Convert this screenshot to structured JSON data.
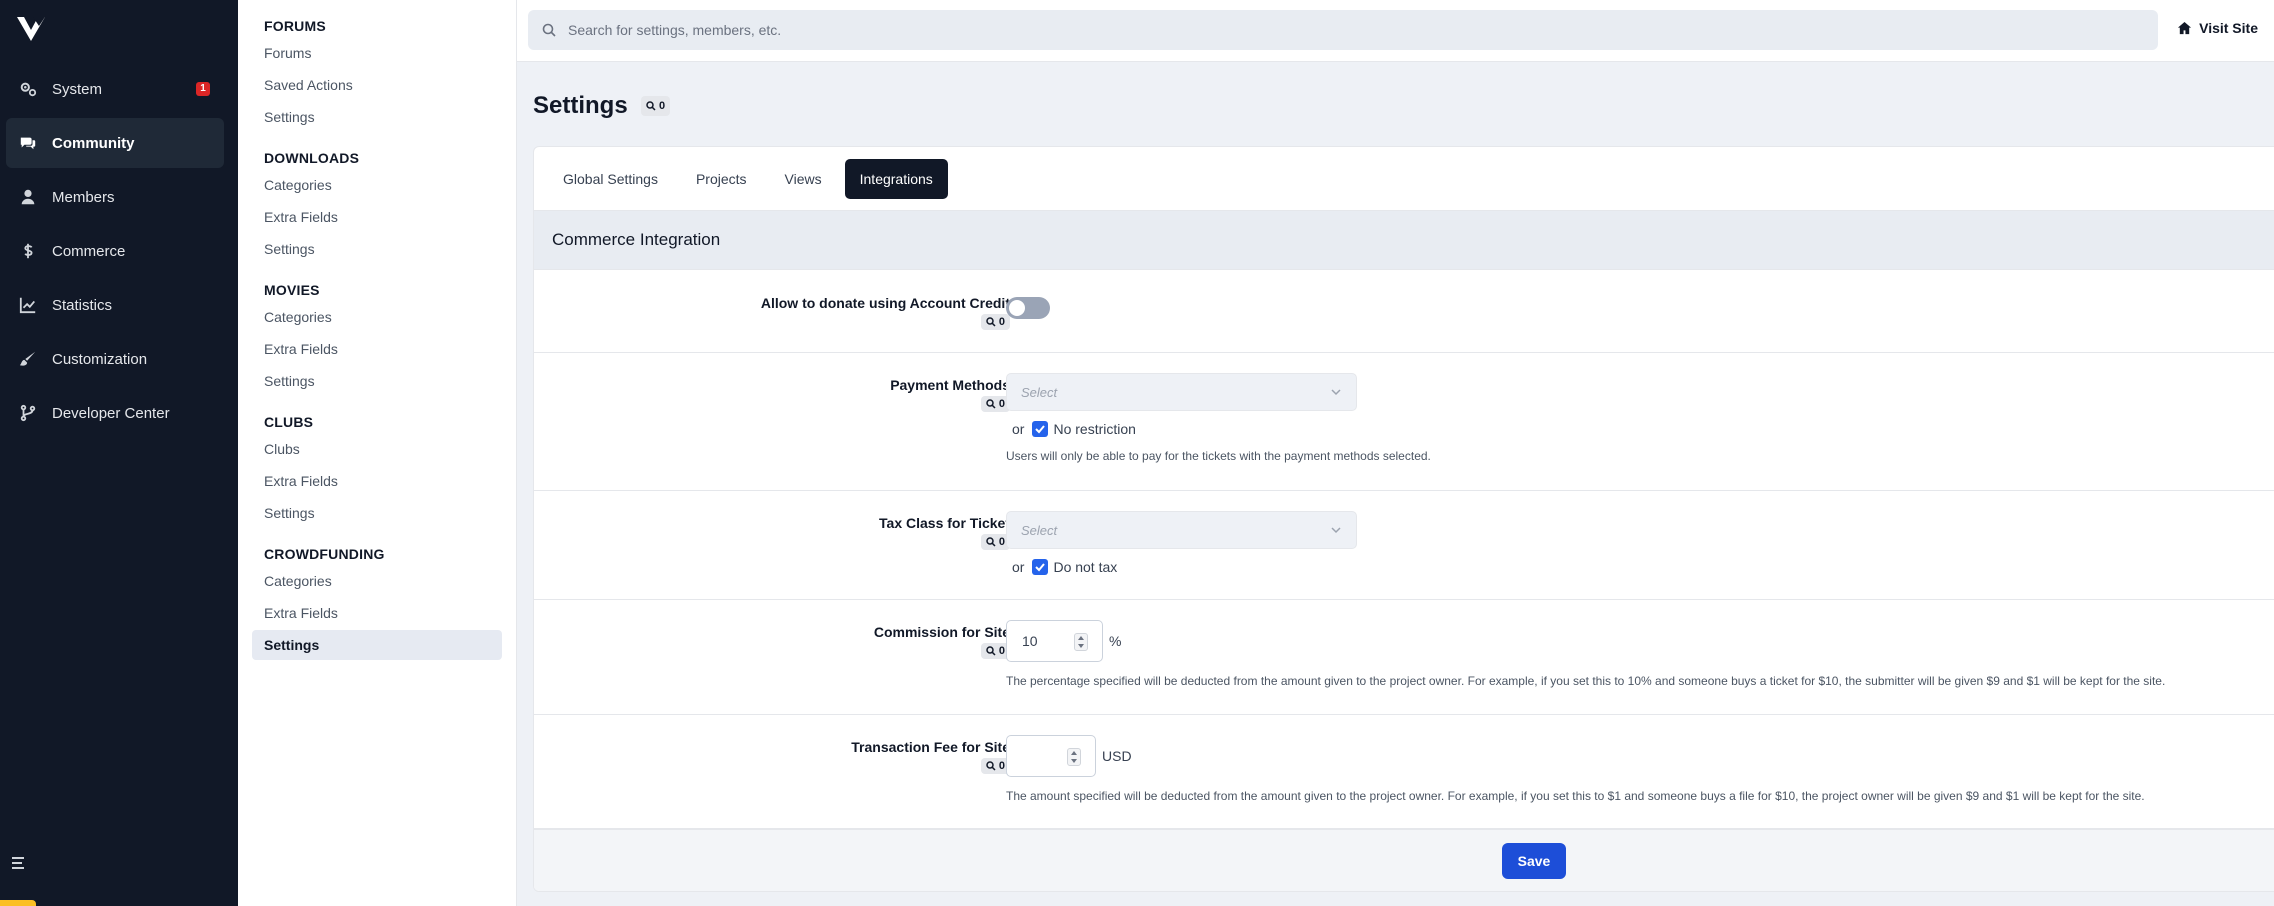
{
  "mainnav": {
    "items": [
      {
        "label": "System",
        "icon": "cogs-icon",
        "badge": "1"
      },
      {
        "label": "Community",
        "icon": "comments-icon"
      },
      {
        "label": "Members",
        "icon": "user-icon"
      },
      {
        "label": "Commerce",
        "icon": "dollar-icon"
      },
      {
        "label": "Statistics",
        "icon": "chart-line-icon"
      },
      {
        "label": "Customization",
        "icon": "brush-icon"
      },
      {
        "label": "Developer Center",
        "icon": "branch-icon"
      }
    ],
    "active": "Community"
  },
  "subnav": {
    "sections": [
      {
        "title": "FORUMS",
        "links": [
          "Forums",
          "Saved Actions",
          "Settings"
        ]
      },
      {
        "title": "DOWNLOADS",
        "links": [
          "Categories",
          "Extra Fields",
          "Settings"
        ]
      },
      {
        "title": "MOVIES",
        "links": [
          "Categories",
          "Extra Fields",
          "Settings"
        ]
      },
      {
        "title": "CLUBS",
        "links": [
          "Clubs",
          "Extra Fields",
          "Settings"
        ]
      },
      {
        "title": "CROWDFUNDING",
        "links": [
          "Categories",
          "Extra Fields",
          "Settings"
        ]
      }
    ]
  },
  "topbar": {
    "search_placeholder": "Search for settings, members, etc.",
    "visit_site": "Visit Site"
  },
  "page": {
    "title": "Settings",
    "title_count": "0"
  },
  "tabs": [
    "Global Settings",
    "Projects",
    "Views",
    "Integrations"
  ],
  "active_tab": "Integrations",
  "section_title": "Commerce Integration",
  "rows": {
    "donate": {
      "label": "Allow to donate using Account Credit",
      "count": "0"
    },
    "payment": {
      "label": "Payment Methods",
      "count": "0",
      "placeholder": "Select",
      "or": "or",
      "checkbox_label": "No restriction",
      "help": "Users will only be able to pay for the tickets with the payment methods selected."
    },
    "tax": {
      "label": "Tax Class for Ticket",
      "count": "0",
      "placeholder": "Select",
      "or": "or",
      "checkbox_label": "Do not tax"
    },
    "commission": {
      "label": "Commission for Site",
      "count": "0",
      "value": "10",
      "unit": "%",
      "help": "The percentage specified will be deducted from the amount given to the project owner. For example, if you set this to 10% and someone buys a ticket for $10, the submitter will be given $9 and $1 will be kept for the site."
    },
    "fee": {
      "label": "Transaction Fee for Site",
      "count": "0",
      "value": "",
      "unit": "USD",
      "help": "The amount specified will be deducted from the amount given to the project owner. For example, if you set this to $1 and someone buys a file for $10, the project owner will be given $9 and $1 will be kept for the site."
    }
  },
  "save_label": "Save",
  "colors": {
    "nav_bg": "#111827",
    "accent": "#1d4ed8",
    "badge": "#dc2626"
  }
}
